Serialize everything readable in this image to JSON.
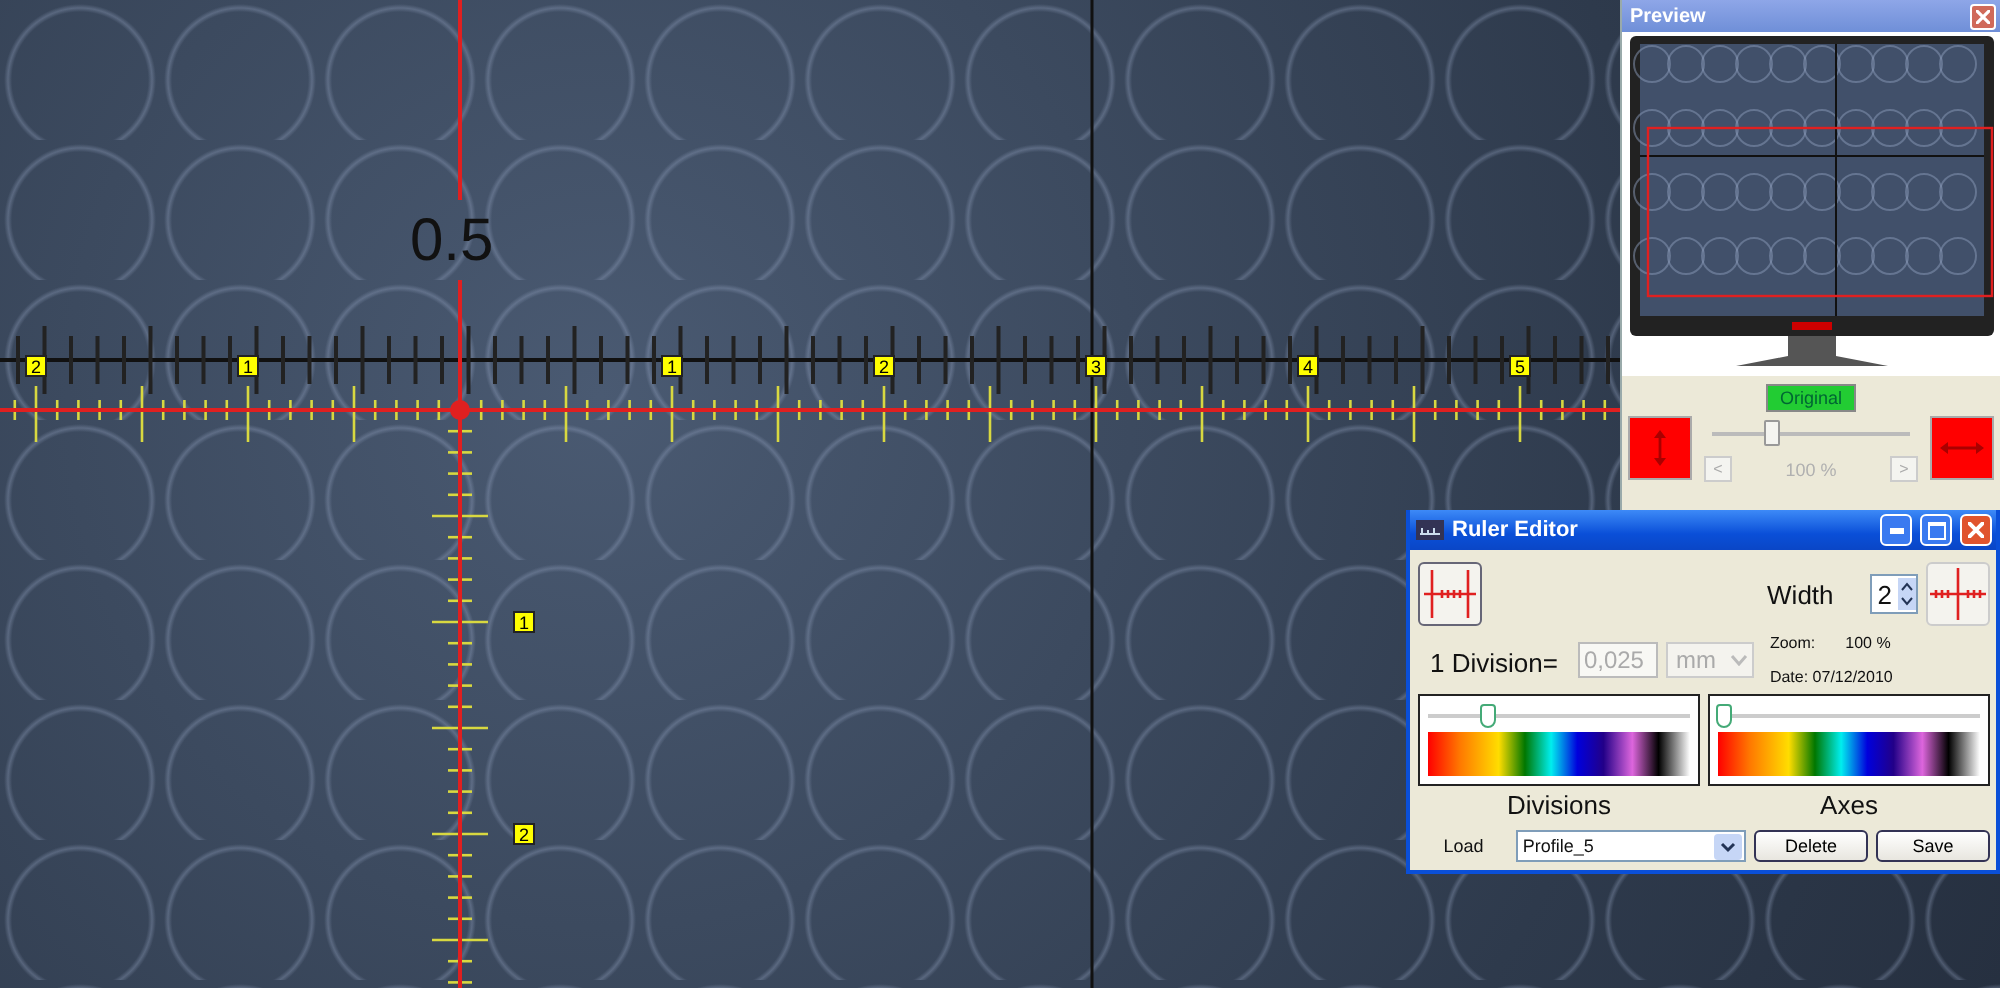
{
  "image_overlay": {
    "measurement": "0.5",
    "h_labels": [
      "2",
      "1",
      "1",
      "2",
      "3",
      "4",
      "5"
    ],
    "v_labels": [
      "1",
      "2"
    ]
  },
  "preview": {
    "title": "Preview",
    "mode_button": "Original",
    "zoom_slider": {
      "level": 0.3
    },
    "prev": "<",
    "zoom_reading": "100 %",
    "next": ">"
  },
  "ruler_editor": {
    "title": "Ruler Editor",
    "width_label": "Width",
    "width_value": "2",
    "division_label": "1 Division=",
    "division_value": "0,025",
    "unit": "mm",
    "fields_disabled": true,
    "zoom_label": "Zoom:",
    "zoom_value": "100 %",
    "date": "Date: 07/12/2010",
    "color_sliders": [
      {
        "label": "Divisions",
        "level": 0.22
      },
      {
        "label": "Axes",
        "level": 0.0
      }
    ],
    "load_label": "Load",
    "profile": "Profile_5",
    "buttons": [
      "Delete",
      "Save"
    ]
  }
}
